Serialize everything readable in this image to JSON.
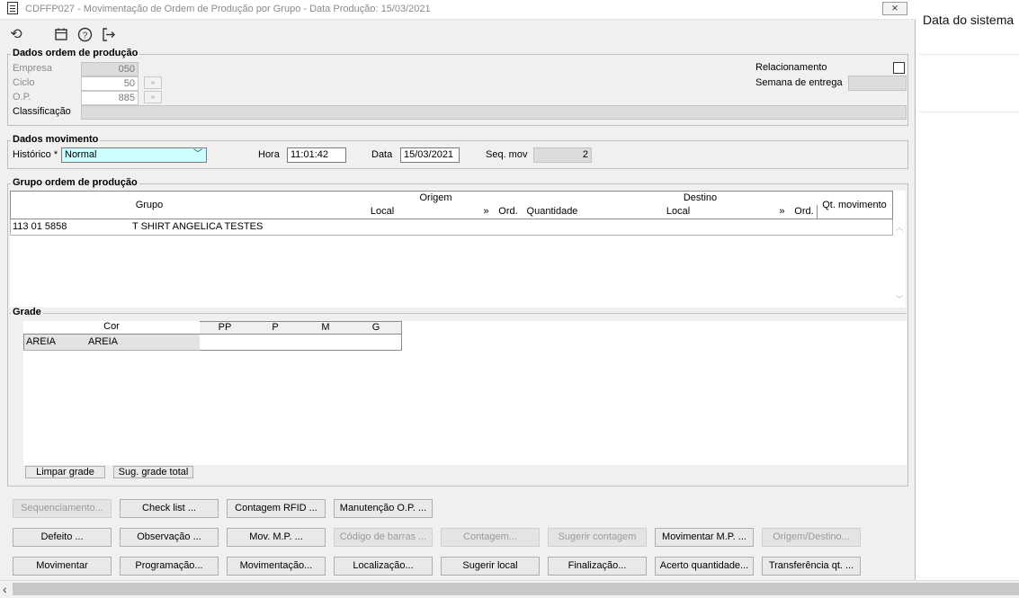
{
  "window": {
    "title": "CDFFP027 - Movimentação de Ordem de Produção por Grupo - Data Produção: 15/03/2021",
    "close_label": "⨯"
  },
  "toolbar": {
    "icons": [
      "refresh-icon",
      "calendar-icon",
      "help-icon",
      "exit-icon"
    ]
  },
  "dados_ordem": {
    "title": "Dados ordem de produção",
    "empresa_label": "Empresa",
    "empresa_value": "050",
    "ciclo_label": "Ciclo",
    "ciclo_value": "50",
    "op_label": "O.P.",
    "op_value": "885",
    "spin_label": "»",
    "classificacao_label": "Classificação",
    "classificacao_value": "",
    "relacionamento_label": "Relacionamento",
    "semana_label": "Semana de entrega",
    "semana_value": ""
  },
  "dados_movimento": {
    "title": "Dados movimento",
    "historico_label": "Histórico *",
    "historico_value": "Normal",
    "hora_label": "Hora",
    "hora_value": "11:01:42",
    "data_label": "Data",
    "data_value": "15/03/2021",
    "seq_label": "Seq. mov",
    "seq_value": "2"
  },
  "grupo_ordem": {
    "title": "Grupo ordem de produção",
    "headers": {
      "grupo": "Grupo",
      "origem": "Origem",
      "destino": "Destino",
      "qt_movimento": "Qt. movimento",
      "origem_local": "Local",
      "origem_arrow": "»",
      "origem_ord": "Ord.",
      "origem_quantidade": "Quantidade",
      "destino_local": "Local",
      "destino_arrow": "»",
      "destino_ord": "Ord."
    },
    "rows": [
      {
        "grupo_code": "113 01 5858",
        "grupo_desc": "T SHIRT ANGELICA TESTES"
      }
    ]
  },
  "grade": {
    "title": "Grade",
    "headers": {
      "cor": "Cor",
      "sizes": [
        "PP",
        "P",
        "M",
        "G"
      ]
    },
    "rows": [
      {
        "cor_code": "AREIA",
        "cor_desc": "AREIA"
      }
    ],
    "limpar_label": "Limpar grade",
    "sugestao_label": "Sug. grade total"
  },
  "buttons": {
    "row1": [
      "Sequenciamento...",
      "Check list ...",
      "Contagem RFID ...",
      "Manutenção O.P. ..."
    ],
    "row2": [
      "Defeito ...",
      "Observação ...",
      "Mov. M.P. ...",
      "Código de barras ...",
      "Contagem...",
      "Sugerir contagem",
      "Movimentar M.P. ...",
      "Origem/Destino..."
    ],
    "row3": [
      "Movimentar",
      "Programação...",
      "Movimentação...",
      "Localização...",
      "Sugerir local",
      "Finalização...",
      "Acerto quantidade...",
      "Transferência qt. ..."
    ]
  },
  "side_panel": {
    "label": "Data do sistema"
  },
  "colors": {
    "window_bg": "#f0f0f0",
    "historico_bg": "#ccffff",
    "disabled_text": "#9a9a9a"
  }
}
